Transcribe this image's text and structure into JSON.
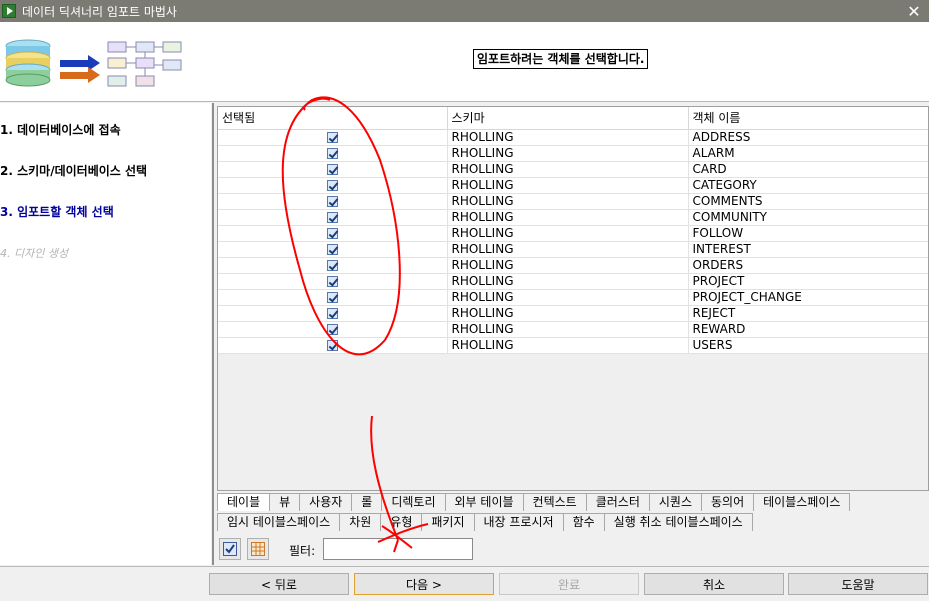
{
  "window": {
    "title": "데이터 딕셔너리 임포트 마법사",
    "close_glyph": "✕",
    "icon": "wizard-app-icon"
  },
  "header": {
    "instruction": "임포트하려는 객체를 선택합니다."
  },
  "steps": [
    {
      "label": "1. 데이터베이스에 접속",
      "state": "done"
    },
    {
      "label": "2. 스키마/데이터베이스 선택",
      "state": "done"
    },
    {
      "label": "3. 임포트할 객체 선택",
      "state": "current"
    },
    {
      "label": "4. 디자인 생성",
      "state": "disabled"
    }
  ],
  "grid": {
    "columns": [
      "선택됨",
      "스키마",
      "객체 이름"
    ],
    "rows": [
      {
        "selected": true,
        "schema": "RHOLLING",
        "name": "ADDRESS"
      },
      {
        "selected": true,
        "schema": "RHOLLING",
        "name": "ALARM"
      },
      {
        "selected": true,
        "schema": "RHOLLING",
        "name": "CARD"
      },
      {
        "selected": true,
        "schema": "RHOLLING",
        "name": "CATEGORY"
      },
      {
        "selected": true,
        "schema": "RHOLLING",
        "name": "COMMENTS"
      },
      {
        "selected": true,
        "schema": "RHOLLING",
        "name": "COMMUNITY"
      },
      {
        "selected": true,
        "schema": "RHOLLING",
        "name": "FOLLOW"
      },
      {
        "selected": true,
        "schema": "RHOLLING",
        "name": "INTEREST"
      },
      {
        "selected": true,
        "schema": "RHOLLING",
        "name": "ORDERS"
      },
      {
        "selected": true,
        "schema": "RHOLLING",
        "name": "PROJECT"
      },
      {
        "selected": true,
        "schema": "RHOLLING",
        "name": "PROJECT_CHANGE"
      },
      {
        "selected": true,
        "schema": "RHOLLING",
        "name": "REJECT"
      },
      {
        "selected": true,
        "schema": "RHOLLING",
        "name": "REWARD"
      },
      {
        "selected": true,
        "schema": "RHOLLING",
        "name": "USERS"
      }
    ]
  },
  "tabs_row1": [
    "테이블",
    "뷰",
    "사용자",
    "롤",
    "디렉토리",
    "외부 테이블",
    "컨텍스트",
    "클러스터",
    "시퀀스",
    "동의어",
    "테이블스페이스"
  ],
  "tabs_row2": [
    "임시 테이블스페이스",
    "차원",
    "유형",
    "패키지",
    "내장 프로시저",
    "함수",
    "실행 취소 테이블스페이스"
  ],
  "active_tab": "테이블",
  "filter": {
    "label": "필터:",
    "value": "",
    "select_all_icon": "check-all-icon",
    "deselect_all_icon": "grid-icon"
  },
  "buttons": {
    "back": "< 뒤로",
    "next": "다음 >",
    "finish": "완료",
    "cancel": "취소",
    "help": "도움말"
  },
  "colors": {
    "title_bar": "#7b7b73",
    "current_step": "#00009c",
    "annotation": "#ff0000"
  }
}
